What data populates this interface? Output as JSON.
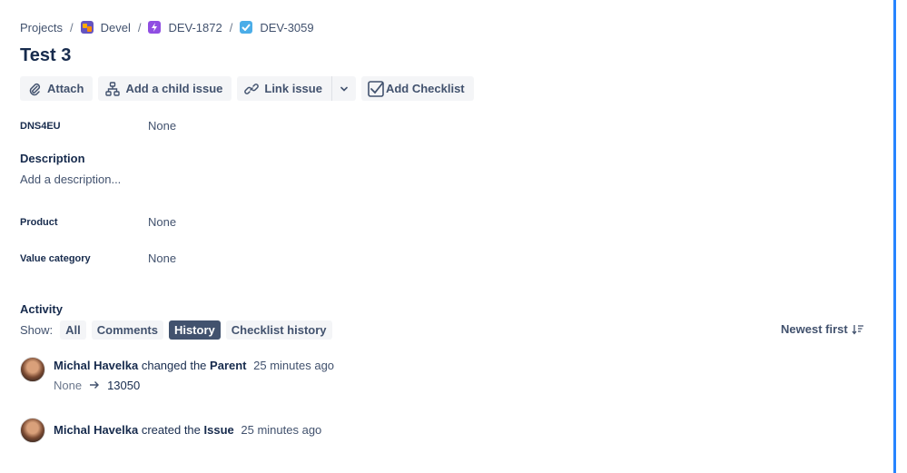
{
  "breadcrumb": {
    "projects": "Projects",
    "separator": "/",
    "project": "Devel",
    "epic": "DEV-1872",
    "issue": "DEV-3059"
  },
  "issue": {
    "title": "Test 3"
  },
  "toolbar": {
    "attach": "Attach",
    "add_child": "Add a child issue",
    "link_issue": "Link issue",
    "add_checklist": "Add Checklist"
  },
  "fields": {
    "dns4eu": {
      "label": "DNS4EU",
      "value": "None"
    },
    "product": {
      "label": "Product",
      "value": "None"
    },
    "value_category": {
      "label": "Value category",
      "value": "None"
    }
  },
  "description": {
    "heading": "Description",
    "placeholder": "Add a description..."
  },
  "activity": {
    "heading": "Activity",
    "show_label": "Show:",
    "filters": [
      "All",
      "Comments",
      "History",
      "Checklist history"
    ],
    "active_filter": "History",
    "sort": "Newest first",
    "entries": [
      {
        "user": "Michal Havelka",
        "action": "changed the",
        "target": "Parent",
        "time": "25 minutes ago",
        "from": "None",
        "to": "13050"
      },
      {
        "user": "Michal Havelka",
        "action": "created the",
        "target": "Issue",
        "time": "25 minutes ago"
      }
    ]
  },
  "colors": {
    "accent_border": "#2684ff",
    "active_chip": "#42526e",
    "text_primary": "#172b4d"
  }
}
